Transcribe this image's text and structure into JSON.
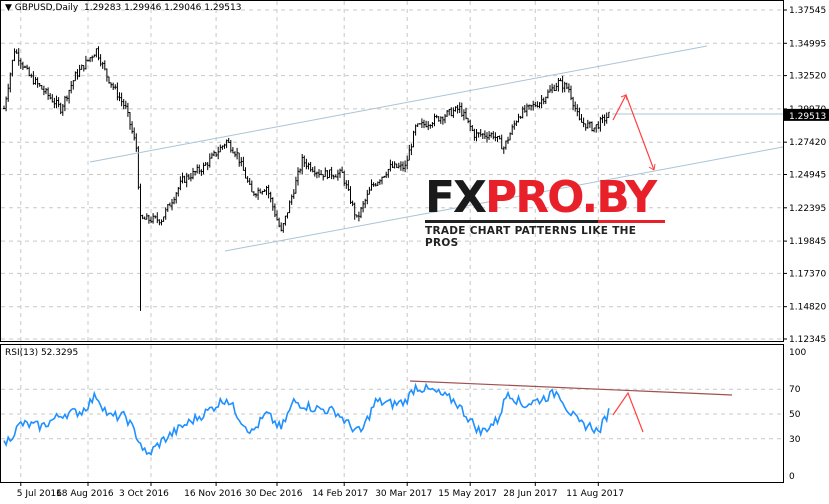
{
  "header": {
    "symbol_label": "GBPUSD,Daily",
    "open": "1.29283",
    "high": "1.29946",
    "low": "1.29046",
    "close": "1.29513"
  },
  "rsi_header": "RSI(13) 52.3295",
  "current_price_label": "1.29513",
  "watermark": {
    "brand_left": "FX",
    "brand_right": "PRO.BY",
    "tagline": "TRADE CHART PATTERNS LIKE THE PROS"
  },
  "colors": {
    "bars": "#000000",
    "channel": "#a9c4d6",
    "rsi": "#1e90ff",
    "rsi_trend": "#a05050",
    "arrows": "#ff4040"
  },
  "chart_data": [
    {
      "type": "bar",
      "title": "GBPUSD,Daily",
      "ylim": [
        1.12345,
        1.37545
      ],
      "y_ticks": [
        "1.37545",
        "1.34995",
        "1.32520",
        "1.29970",
        "1.27420",
        "1.24945",
        "1.22395",
        "1.19845",
        "1.17370",
        "1.14820",
        "1.12345"
      ],
      "x_ticks": [
        "5 Jul 2016",
        "18 Aug 2016",
        "3 Oct 2016",
        "16 Nov 2016",
        "30 Dec 2016",
        "14 Feb 2017",
        "30 Mar 2017",
        "15 May 2017",
        "28 Jun 2017",
        "11 Aug 2017"
      ],
      "x_tick_bars": [
        8,
        40,
        70,
        101,
        130,
        162,
        192,
        222,
        253,
        283
      ],
      "closes_by_bar": [
        [
          0,
          1.3
        ],
        [
          5,
          1.345
        ],
        [
          12,
          1.325
        ],
        [
          27,
          1.3
        ],
        [
          34,
          1.325
        ],
        [
          44,
          1.345
        ],
        [
          49,
          1.325
        ],
        [
          58,
          1.3
        ],
        [
          63,
          1.27
        ],
        [
          65,
          1.215
        ],
        [
          75,
          1.215
        ],
        [
          85,
          1.245
        ],
        [
          95,
          1.255
        ],
        [
          106,
          1.275
        ],
        [
          111,
          1.265
        ],
        [
          118,
          1.235
        ],
        [
          125,
          1.24
        ],
        [
          132,
          1.205
        ],
        [
          142,
          1.26
        ],
        [
          151,
          1.25
        ],
        [
          161,
          1.25
        ],
        [
          168,
          1.215
        ],
        [
          175,
          1.24
        ],
        [
          184,
          1.255
        ],
        [
          191,
          1.255
        ],
        [
          196,
          1.285
        ],
        [
          203,
          1.29
        ],
        [
          217,
          1.3
        ],
        [
          224,
          1.28
        ],
        [
          233,
          1.28
        ],
        [
          238,
          1.27
        ],
        [
          245,
          1.295
        ],
        [
          255,
          1.305
        ],
        [
          264,
          1.32
        ],
        [
          269,
          1.315
        ],
        [
          274,
          1.29
        ],
        [
          281,
          1.285
        ],
        [
          288,
          1.295
        ]
      ],
      "flash_crash": {
        "bar": 65,
        "low": 1.145
      }
    },
    {
      "type": "line",
      "title": "RSI(13) 52.3295",
      "ylim": [
        0,
        100
      ],
      "y_ticks": [
        "100",
        "70",
        "50",
        "30",
        "0"
      ],
      "points": [
        [
          0,
          25
        ],
        [
          8,
          42
        ],
        [
          18,
          40
        ],
        [
          28,
          50
        ],
        [
          37,
          52
        ],
        [
          44,
          65
        ],
        [
          50,
          48
        ],
        [
          58,
          48
        ],
        [
          63,
          33
        ],
        [
          68,
          16
        ],
        [
          75,
          28
        ],
        [
          85,
          40
        ],
        [
          95,
          50
        ],
        [
          106,
          63
        ],
        [
          113,
          45
        ],
        [
          118,
          35
        ],
        [
          125,
          50
        ],
        [
          132,
          38
        ],
        [
          138,
          60
        ],
        [
          147,
          55
        ],
        [
          158,
          52
        ],
        [
          165,
          40
        ],
        [
          170,
          35
        ],
        [
          177,
          60
        ],
        [
          186,
          58
        ],
        [
          191,
          60
        ],
        [
          196,
          72
        ],
        [
          205,
          68
        ],
        [
          215,
          60
        ],
        [
          222,
          45
        ],
        [
          227,
          35
        ],
        [
          235,
          45
        ],
        [
          240,
          68
        ],
        [
          247,
          57
        ],
        [
          256,
          62
        ],
        [
          264,
          68
        ],
        [
          268,
          55
        ],
        [
          274,
          42
        ],
        [
          280,
          40
        ],
        [
          283,
          35
        ],
        [
          288,
          52
        ]
      ]
    }
  ]
}
